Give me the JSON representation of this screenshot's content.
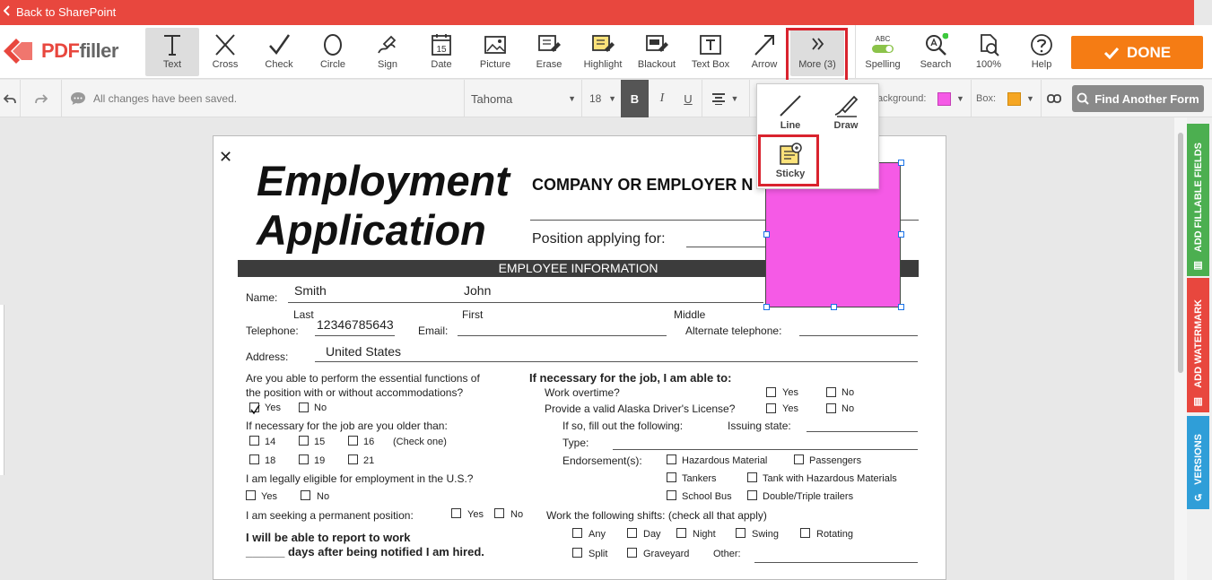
{
  "topbar": {
    "back_label": "Back to SharePoint"
  },
  "logo": {
    "pdf": "PDF",
    "filler": "filler"
  },
  "tools": [
    {
      "label": "Text",
      "icon": "text-icon"
    },
    {
      "label": "Cross",
      "icon": "cross-icon"
    },
    {
      "label": "Check",
      "icon": "check-icon"
    },
    {
      "label": "Circle",
      "icon": "circle-icon"
    },
    {
      "label": "Sign",
      "icon": "sign-icon"
    },
    {
      "label": "Date",
      "icon": "calendar-icon",
      "day": "15"
    },
    {
      "label": "Picture",
      "icon": "picture-icon"
    },
    {
      "label": "Erase",
      "icon": "eraser-icon"
    },
    {
      "label": "Highlight",
      "icon": "highlight-icon"
    },
    {
      "label": "Blackout",
      "icon": "blackout-icon"
    },
    {
      "label": "Text Box",
      "icon": "textbox-icon"
    },
    {
      "label": "Arrow",
      "icon": "arrow-icon"
    },
    {
      "label": "More (3)",
      "icon": "chevrons-right-icon"
    }
  ],
  "right_tools": [
    {
      "label": "Spelling",
      "icon": "toggle-icon",
      "tag": "ABC"
    },
    {
      "label": "Search",
      "icon": "search-icon"
    },
    {
      "label": "100%",
      "icon": "zoom-icon"
    },
    {
      "label": "Help",
      "icon": "help-icon"
    }
  ],
  "done": {
    "label": "DONE"
  },
  "formatbar": {
    "status": "All changes have been saved.",
    "font": "Tahoma",
    "size": "18",
    "bold": "B",
    "italic": "I",
    "underline": "U",
    "background_label": "ackground:",
    "box_label": "Box:",
    "find_form": "Find Another Form"
  },
  "colors": {
    "accent": "#e8473e",
    "done": "#f57c14",
    "sticky": "#f55ae6",
    "box": "#f5a623",
    "tab_green": "#4caf50",
    "tab_red": "#e8473e",
    "tab_blue": "#2f9ed8"
  },
  "more_menu": {
    "line": "Line",
    "draw": "Draw",
    "sticky": "Sticky"
  },
  "side_tabs": {
    "fillable": "ADD FILLABLE FIELDS",
    "watermark": "ADD WATERMARK",
    "versions": "VERSIONS"
  },
  "form": {
    "title1": "Employment",
    "title2": "Application",
    "company": "COMPANY OR EMPLOYER N",
    "position": "Position applying for:",
    "section": "EMPLOYEE INFORMATION",
    "name_label": "Name:",
    "last_value": "Smith",
    "first_value": "John",
    "last": "Last",
    "first": "First",
    "middle": "Middle",
    "telephone_label": "Telephone:",
    "telephone_value": "12346785643",
    "email_label": "Email:",
    "alt_phone_label": "Alternate telephone:",
    "address_label": "Address:",
    "address_value": "United States",
    "q_essential_1": "Are you able to perform the essential functions of",
    "q_essential_2": "the position with or without accommodations?",
    "yes": "Yes",
    "no": "No",
    "q_older": "If necessary for the job are you older than:",
    "ages": [
      "14",
      "15",
      "16",
      "18",
      "19",
      "21"
    ],
    "check_one": "(Check one)",
    "q_eligible": "I am legally eligible for employment in the U.S.?",
    "q_permanent": "I am seeking a permanent position:",
    "report_1": "I will be able to report to work",
    "report_2": "______ days after being notified I am hired.",
    "q_able": "If necessary for the job, I am able to:",
    "overtime": "Work overtime?",
    "license": "Provide a valid Alaska Driver's License?",
    "fill_out": "If so, fill out the following:",
    "issuing_state": "Issuing state:",
    "type": "Type:",
    "endorsements": "Endorsement(s):",
    "endorse_items": [
      "Hazardous Material",
      "Passengers",
      "Tankers",
      "Tank with Hazardous Materials",
      "School Bus",
      "Double/Triple trailers"
    ],
    "shifts_label": "Work the following shifts: (check all that apply)",
    "shifts": [
      "Any",
      "Day",
      "Night",
      "Swing",
      "Rotating",
      "Split",
      "Graveyard"
    ],
    "other": "Other:"
  }
}
